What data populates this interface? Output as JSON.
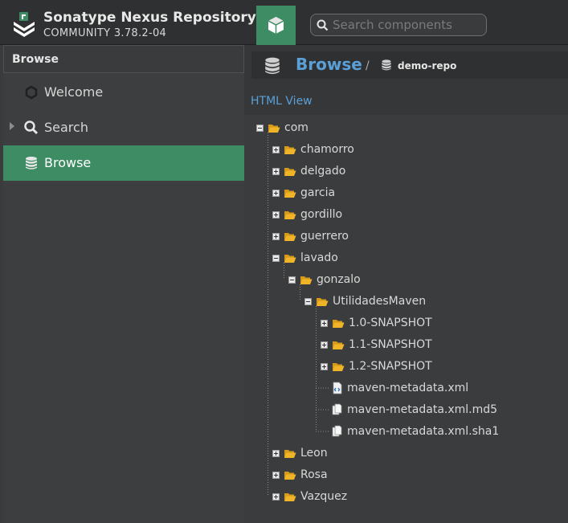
{
  "header": {
    "title": "Sonatype Nexus Repository",
    "subtitle": "COMMUNITY 3.78.2-04",
    "search_placeholder": "Search components"
  },
  "sidebar": {
    "heading": "Browse",
    "items": [
      {
        "label": "Welcome",
        "icon": "hexagon-icon",
        "active": false
      },
      {
        "label": "Search",
        "icon": "search-icon",
        "active": false,
        "expandable": true
      },
      {
        "label": "Browse",
        "icon": "database-icon",
        "active": true
      }
    ]
  },
  "breadcrumb": {
    "title": "Browse",
    "separator": "/",
    "repo": "demo-repo"
  },
  "html_view_link": "HTML View",
  "tree": [
    {
      "label": "com",
      "type": "folder",
      "state": "expanded",
      "depth": 0
    },
    {
      "label": "chamorro",
      "type": "folder",
      "state": "collapsed",
      "depth": 1
    },
    {
      "label": "delgado",
      "type": "folder",
      "state": "collapsed",
      "depth": 1
    },
    {
      "label": "garcia",
      "type": "folder",
      "state": "collapsed",
      "depth": 1
    },
    {
      "label": "gordillo",
      "type": "folder",
      "state": "collapsed",
      "depth": 1
    },
    {
      "label": "guerrero",
      "type": "folder",
      "state": "collapsed",
      "depth": 1
    },
    {
      "label": "lavado",
      "type": "folder",
      "state": "expanded",
      "depth": 1
    },
    {
      "label": "gonzalo",
      "type": "folder",
      "state": "expanded",
      "depth": 2
    },
    {
      "label": "UtilidadesMaven",
      "type": "folder",
      "state": "expanded",
      "depth": 3
    },
    {
      "label": "1.0-SNAPSHOT",
      "type": "folder",
      "state": "collapsed",
      "depth": 4
    },
    {
      "label": "1.1-SNAPSHOT",
      "type": "folder",
      "state": "collapsed",
      "depth": 4
    },
    {
      "label": "1.2-SNAPSHOT",
      "type": "folder",
      "state": "collapsed",
      "depth": 4
    },
    {
      "label": "maven-metadata.xml",
      "type": "xml-file",
      "depth": 4
    },
    {
      "label": "maven-metadata.xml.md5",
      "type": "file",
      "depth": 4
    },
    {
      "label": "maven-metadata.xml.sha1",
      "type": "file",
      "depth": 4
    },
    {
      "label": "Leon",
      "type": "folder",
      "state": "collapsed",
      "depth": 1
    },
    {
      "label": "Rosa",
      "type": "folder",
      "state": "collapsed",
      "depth": 1
    },
    {
      "label": "Vazquez",
      "type": "folder",
      "state": "collapsed",
      "depth": 1
    }
  ],
  "colors": {
    "accent_green": "#3e8c63",
    "link_blue": "#5aa0d8",
    "folder_yellow": "#f0b429"
  }
}
